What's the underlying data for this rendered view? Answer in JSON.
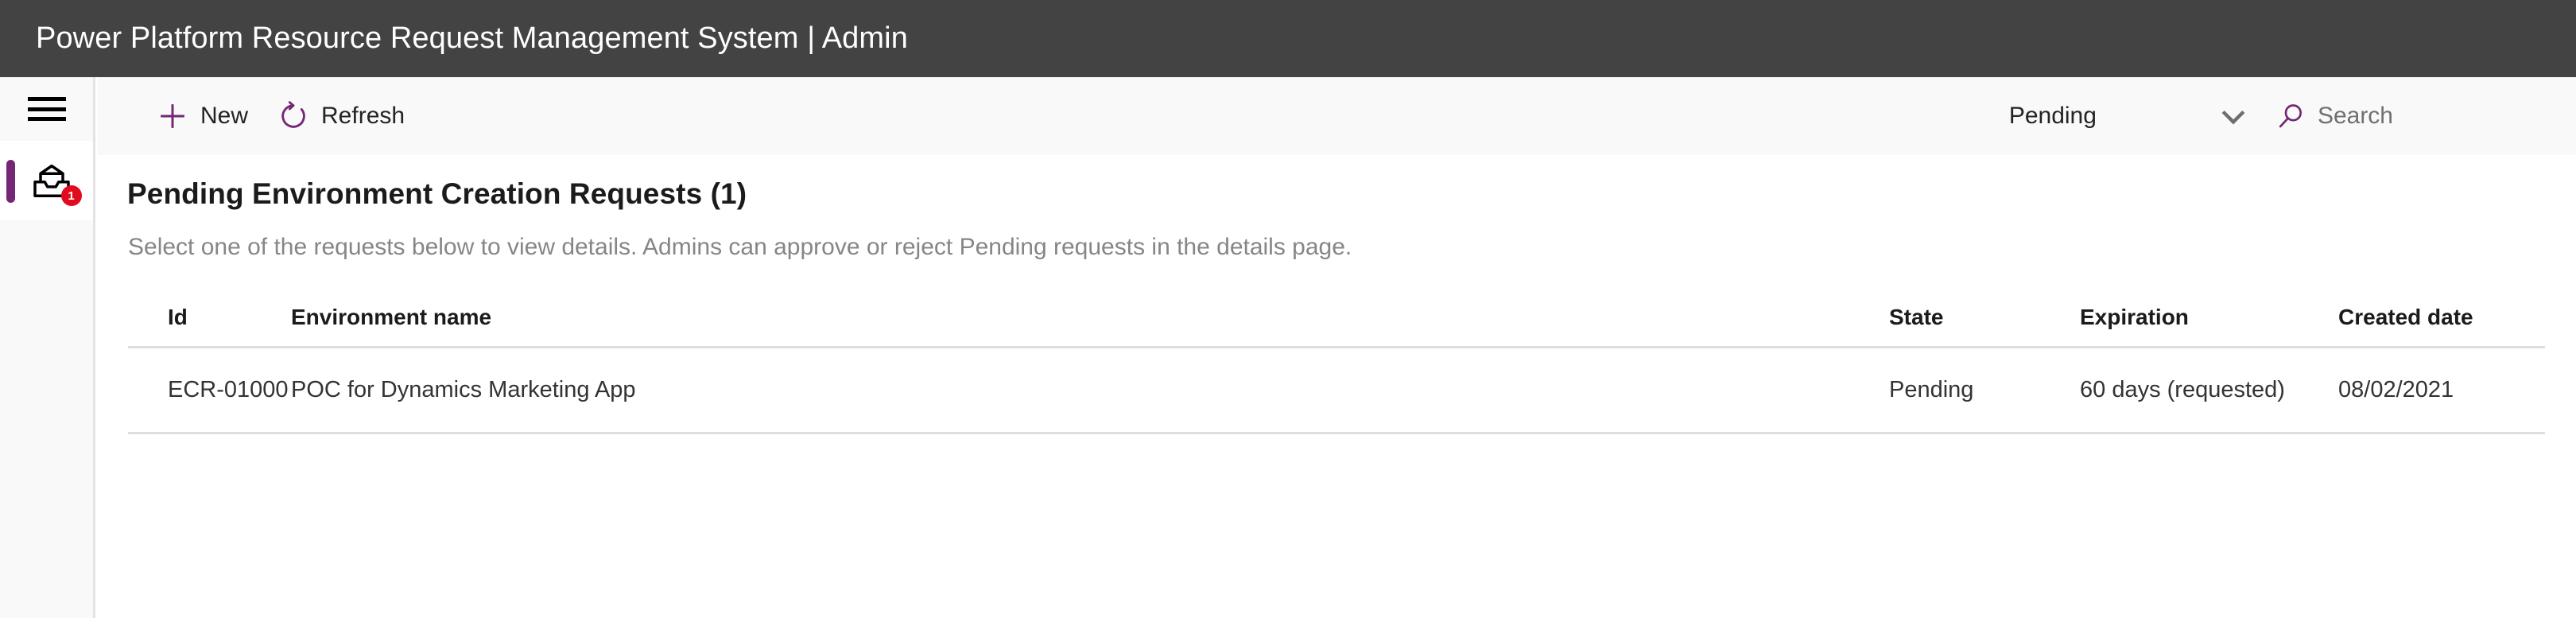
{
  "app": {
    "title": "Power Platform Resource Request Management System | Admin",
    "header_bg": "#434343",
    "accent": "#742774",
    "badge_color": "#e00b1c"
  },
  "sidebar": {
    "menu_toggle": {
      "name": "hamburger-menu",
      "icon": "hamburger-icon"
    },
    "items": [
      {
        "label": "Requests",
        "icon": "inbox-icon",
        "badge": "1",
        "selected": true
      }
    ]
  },
  "command_bar": {
    "buttons": [
      {
        "label": "New",
        "icon": "plus-icon"
      },
      {
        "label": "Refresh",
        "icon": "refresh-icon"
      }
    ],
    "view_picker": {
      "selected": "Pending",
      "chevron_icon": "chevron-down-icon",
      "options": [
        "Pending"
      ]
    },
    "search": {
      "icon": "search-icon",
      "placeholder": "Search",
      "value": ""
    }
  },
  "main": {
    "title": "Pending Environment Creation Requests (1)",
    "subtitle": "Select one of the requests below to view details. Admins can approve or reject Pending requests in the details page.",
    "table": {
      "columns": [
        "Id",
        "Environment name",
        "State",
        "Expiration",
        "Created date"
      ],
      "rows": [
        {
          "id": "ECR-01000",
          "environment_name": "POC for Dynamics Marketing App",
          "state": "Pending",
          "expiration": "60 days (requested)",
          "created_date": "08/02/2021"
        }
      ]
    }
  }
}
